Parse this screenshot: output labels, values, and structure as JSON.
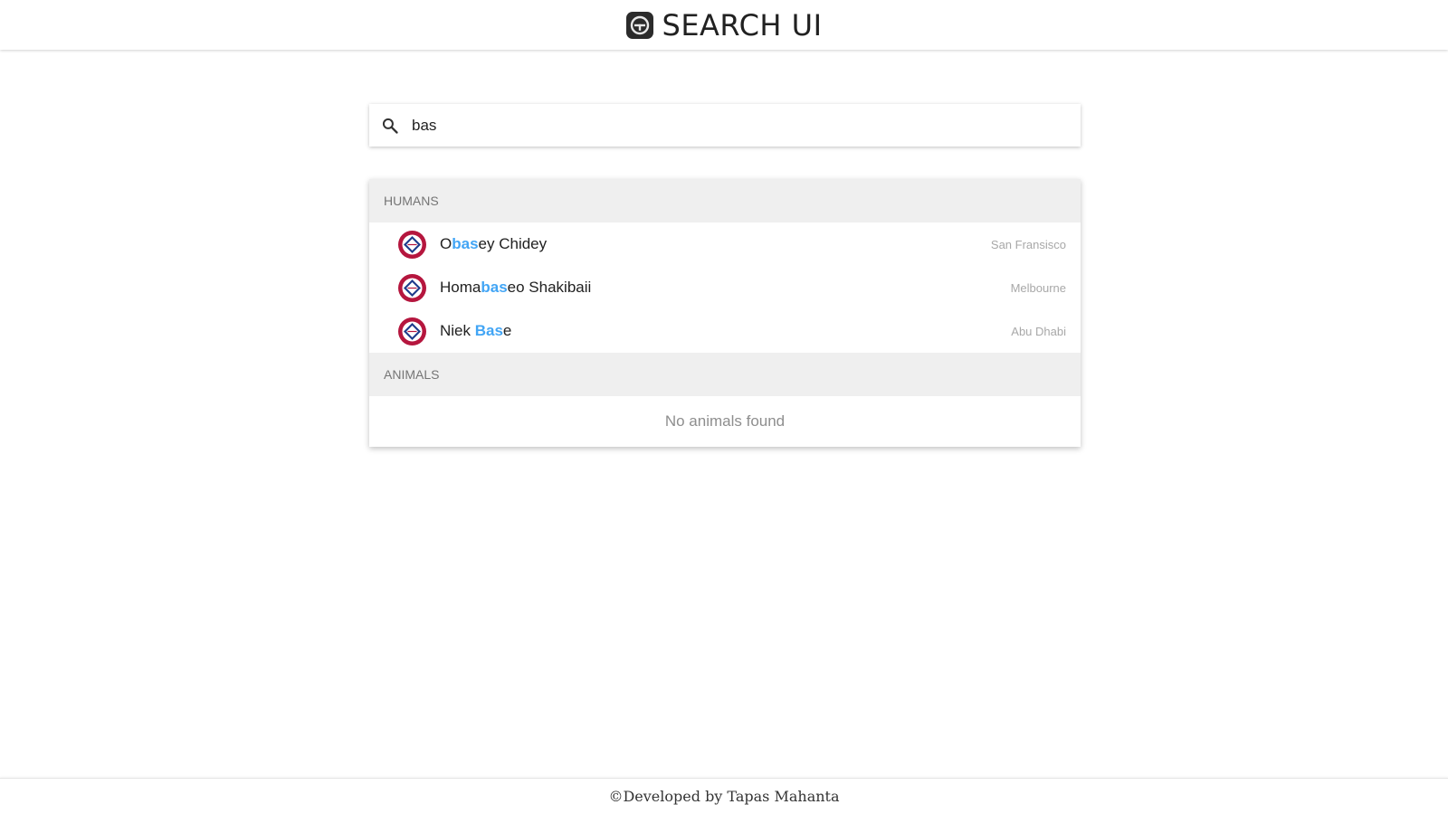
{
  "header": {
    "title": "SEARCH UI",
    "logo_icon": "letter-e-logo-icon"
  },
  "search": {
    "value": "bas",
    "icon": "search-icon"
  },
  "results": {
    "sections": [
      {
        "title": "HUMANS",
        "items": [
          {
            "name_parts": [
              "O",
              "bas",
              "ey Chidey"
            ],
            "city": "San Fransisco",
            "icon": "diamond-badge-icon"
          },
          {
            "name_parts": [
              "Homa",
              "bas",
              "eo Shakibaii"
            ],
            "city": "Melbourne",
            "icon": "diamond-badge-icon"
          },
          {
            "name_parts": [
              "Niek ",
              "Bas",
              "e"
            ],
            "city": "Abu Dhabi",
            "icon": "diamond-badge-icon"
          }
        ]
      },
      {
        "title": "ANIMALS",
        "empty_text": "No animals found"
      }
    ]
  },
  "footer": {
    "text": "©Developed by Tapas Mahanta"
  },
  "colors": {
    "highlight": "#42a5f5",
    "avatar": "#b5163e",
    "section_bg": "#efefef"
  }
}
